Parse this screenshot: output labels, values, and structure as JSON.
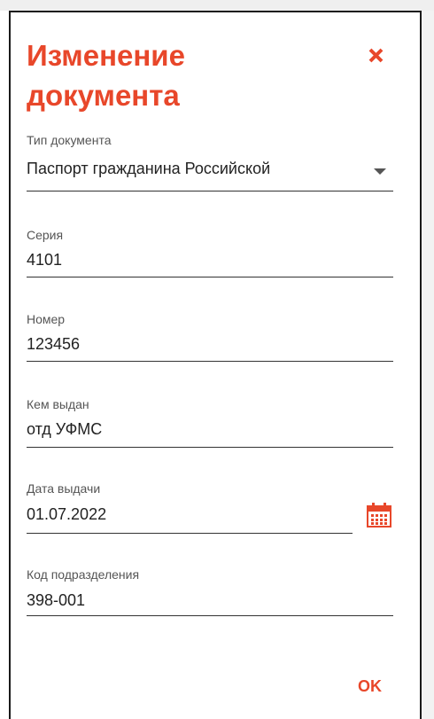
{
  "dialog": {
    "title": "Изменение документа",
    "close_icon": "close-icon",
    "ok_label": "OK"
  },
  "fields": {
    "doc_type": {
      "label": "Тип документа",
      "value": "Паспорт гражданина Российской"
    },
    "series": {
      "label": "Серия",
      "value": "4101"
    },
    "number": {
      "label": "Номер",
      "value": "123456"
    },
    "issued_by": {
      "label": "Кем выдан",
      "value": "отд УФМС"
    },
    "issue_date": {
      "label": "Дата выдачи",
      "value": "01.07.2022"
    },
    "division_code": {
      "label": "Код подразделения",
      "value": "398-001"
    }
  },
  "icons": {
    "dropdown": "chevron-down-icon",
    "calendar": "calendar-icon"
  },
  "colors": {
    "accent": "#e8472a",
    "text": "#222222",
    "label": "#555555"
  }
}
